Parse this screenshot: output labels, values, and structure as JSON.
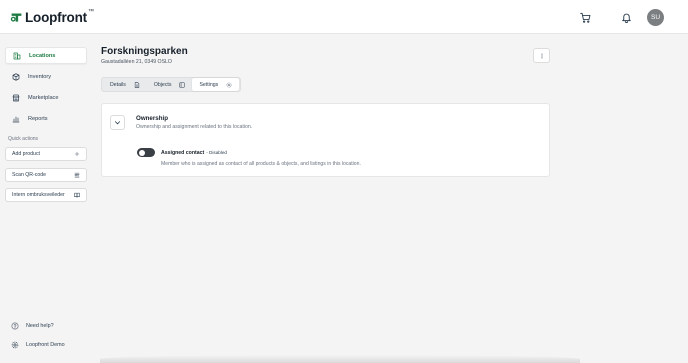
{
  "app": {
    "logo_text": "Loopfront",
    "logo_tm": "™",
    "brand_color": "#1e7b43"
  },
  "topbar": {
    "cart_icon": "cart-icon",
    "bell_icon": "bell-icon",
    "avatar_initials": "SU"
  },
  "sidebar": {
    "items": [
      {
        "label": "Locations",
        "icon": "building-icon",
        "active": true
      },
      {
        "label": "Inventory",
        "icon": "cube-icon",
        "active": false
      },
      {
        "label": "Marketplace",
        "icon": "store-icon",
        "active": false
      },
      {
        "label": "Reports",
        "icon": "bar-chart-icon",
        "active": false
      }
    ],
    "quick_actions_title": "Quick actions",
    "quick_actions": [
      {
        "label": "Add product",
        "icon": "plus-icon"
      },
      {
        "label": "Scan QR-code",
        "icon": "qr-code-icon"
      },
      {
        "label": "Intern ombruksveileder",
        "icon": "book-icon"
      }
    ],
    "help_label": "Need help?",
    "org_label": "Loopfront Demo"
  },
  "page": {
    "title": "Forskningsparken",
    "address": "Gaustadalléen 21, 0349 OSLO"
  },
  "tabs": [
    {
      "label": "Details",
      "icon": "document-icon",
      "active": false
    },
    {
      "label": "Objects",
      "icon": "objects-icon",
      "active": false
    },
    {
      "label": "Settings",
      "icon": "gear-icon",
      "active": true
    }
  ],
  "ownership": {
    "title": "Ownership",
    "description": "Ownership and assignment related to this location.",
    "toggle_label": "Assigned contact",
    "toggle_state": "- Disabled",
    "toggle_enabled": false,
    "toggle_description": "Member who is assigned as contact of all products & objects, and listings in this location."
  }
}
